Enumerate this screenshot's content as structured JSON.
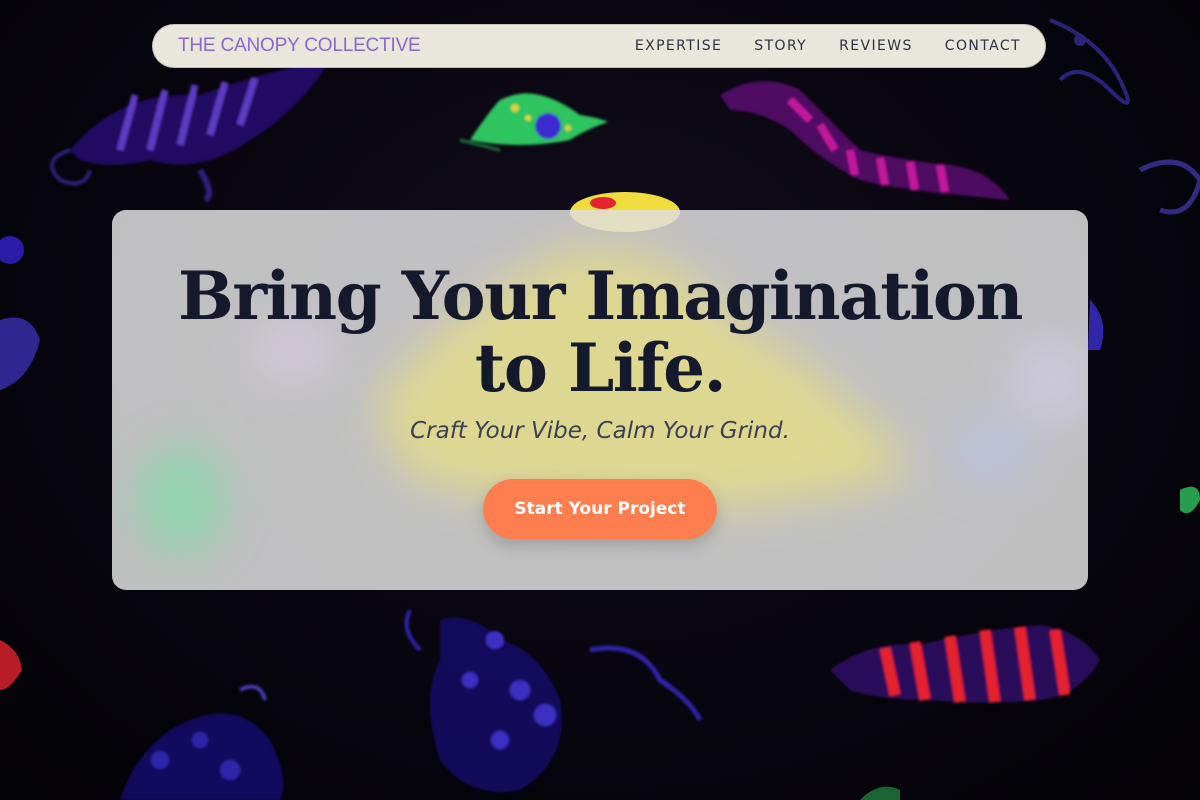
{
  "brand": {
    "name": "THE CANOPY COLLECTIVE",
    "color": "#8a68d0"
  },
  "nav": {
    "items": [
      {
        "label": "EXPERTISE"
      },
      {
        "label": "STORY"
      },
      {
        "label": "REVIEWS"
      },
      {
        "label": "CONTACT"
      }
    ]
  },
  "hero": {
    "title": "Bring Your Imagination to Life.",
    "subtitle": "Craft Your Vibe, Calm Your Grind.",
    "cta_label": "Start Your Project",
    "cta_color": "#ff7e4f"
  },
  "background": {
    "description_colors": [
      "#5a2bd8",
      "#c21fb0",
      "#e8232f",
      "#35d06a",
      "#f4e04a"
    ]
  }
}
